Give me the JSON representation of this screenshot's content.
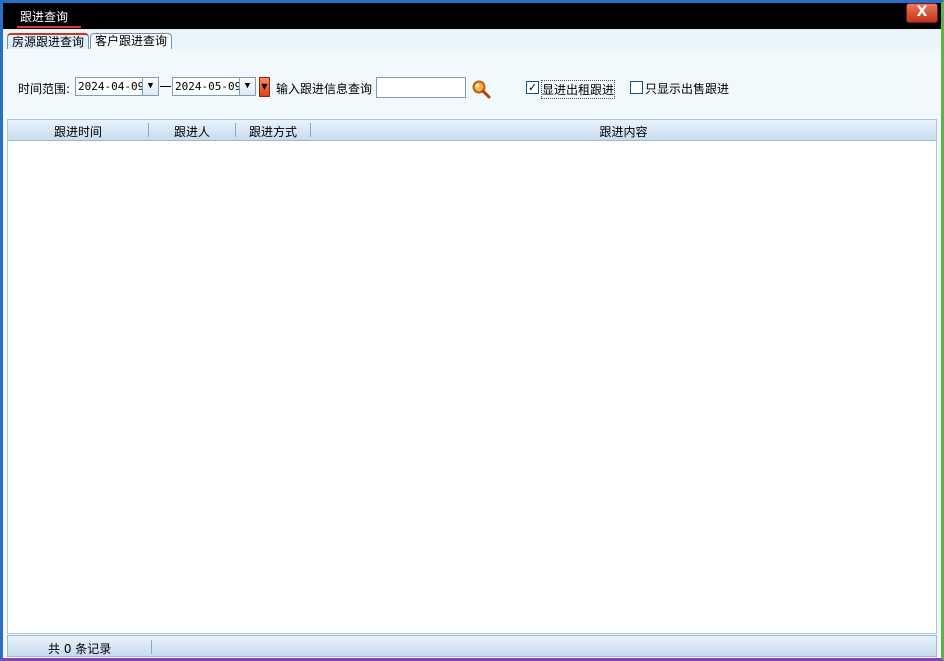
{
  "window": {
    "title": "跟进查询",
    "close_label": "X"
  },
  "tabs": [
    {
      "label": "房源跟进查询",
      "active": true
    },
    {
      "label": "客户跟进查询",
      "active": false
    }
  ],
  "filter": {
    "time_range_label": "时间范围:",
    "start_date": "2024-04-09",
    "end_date": "2024-05-09",
    "search_label": "输入跟进信息查询",
    "search_value": "",
    "checkbox_rental": {
      "label": "显进出租跟进",
      "checked": true
    },
    "checkbox_sale": {
      "label": "只显示出售跟进",
      "checked": false
    }
  },
  "grid": {
    "columns": [
      "跟进时间",
      "跟进人",
      "跟进方式",
      "跟进内容"
    ],
    "rows": []
  },
  "footer": {
    "record_count_text": "共 0 条记录"
  }
}
